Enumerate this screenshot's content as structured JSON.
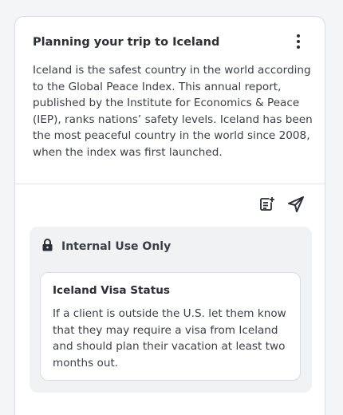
{
  "card": {
    "title": "Planning your trip to Iceland",
    "body": "Iceland is the safest country in the world according to the Global Peace Index. This annual report, published by the Institute for Economics & Peace (IEP), ranks nations’ safety levels. Iceland has been the most peaceful country in the world since 2008, when the index was first launched.",
    "menu_icon": "kebab-menu-icon",
    "actions": [
      {
        "icon": "add-note-icon"
      },
      {
        "icon": "send-icon"
      }
    ]
  },
  "internal": {
    "label": "Internal Use Only",
    "icon": "lock-icon",
    "note": {
      "title": "Iceland Visa Status",
      "text": "If a client is outside the U.S. let them know that they may require a visa from Iceland and should plan their vacation at least two months out."
    }
  },
  "colors": {
    "background": "#f4f5f7",
    "card": "#ffffff",
    "panel": "#f1f2f4",
    "text": "#2b2f36",
    "border": "#d9dce1"
  }
}
